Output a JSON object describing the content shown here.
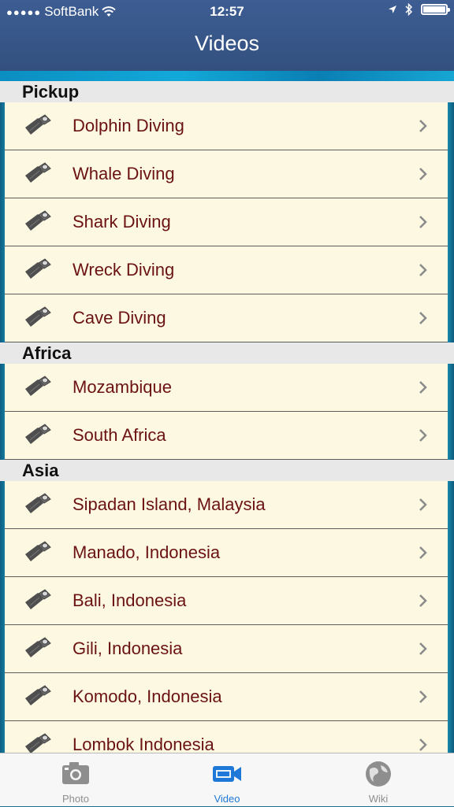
{
  "status_bar": {
    "carrier": "SoftBank",
    "time": "12:57"
  },
  "nav": {
    "title": "Videos"
  },
  "sections": [
    {
      "header": "Pickup",
      "items": [
        "Dolphin Diving",
        "Whale Diving",
        "Shark Diving",
        "Wreck Diving",
        "Cave Diving"
      ]
    },
    {
      "header": "Africa",
      "items": [
        "Mozambique",
        "South Africa"
      ]
    },
    {
      "header": "Asia",
      "items": [
        "Sipadan Island, Malaysia",
        "Manado, Indonesia",
        "Bali, Indonesia",
        "Gili, Indonesia",
        "Komodo, Indonesia",
        "Lombok Indonesia"
      ]
    }
  ],
  "tabs": [
    {
      "label": "Photo",
      "icon": "camera-icon",
      "active": false
    },
    {
      "label": "Video",
      "icon": "video-camera-icon",
      "active": true
    },
    {
      "label": "Wiki",
      "icon": "globe-icon",
      "active": false
    }
  ],
  "colors": {
    "nav_bar": "#3d5d93",
    "row_background": "#fcf8e2",
    "row_text": "#6b1212",
    "section_header": "#e8e8e8",
    "tab_active": "#1e78d8",
    "tab_inactive": "#8e8e8e"
  }
}
